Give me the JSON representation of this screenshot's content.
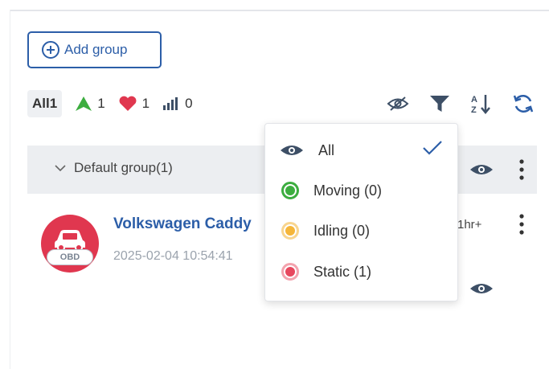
{
  "toolbar": {
    "add_group_label": "Add group"
  },
  "filters": {
    "all": {
      "label": "All",
      "count": "1"
    },
    "moving": {
      "count": "1",
      "color": "#3cad3f"
    },
    "favorite": {
      "count": "1",
      "color": "#e0374f"
    },
    "signal": {
      "count": "0"
    }
  },
  "group": {
    "name": "Default group(1)"
  },
  "vehicle": {
    "name": "Volkswagen Caddy",
    "timestamp": "2025-02-04 10:54:41",
    "duration": "1hr+",
    "badge": "OBD",
    "avatar_color": "#e0374f"
  },
  "status_menu": {
    "items": [
      {
        "label": "All",
        "icon": "eye-icon",
        "selected": true
      },
      {
        "label": "Moving (0)",
        "color": "#3cad3f"
      },
      {
        "label": "Idling (0)",
        "color": "#f5b63a"
      },
      {
        "label": "Static (1)",
        "color": "#e7485e"
      }
    ]
  },
  "colors": {
    "accent": "#2c5ea8",
    "icon": "#3d4f66"
  }
}
